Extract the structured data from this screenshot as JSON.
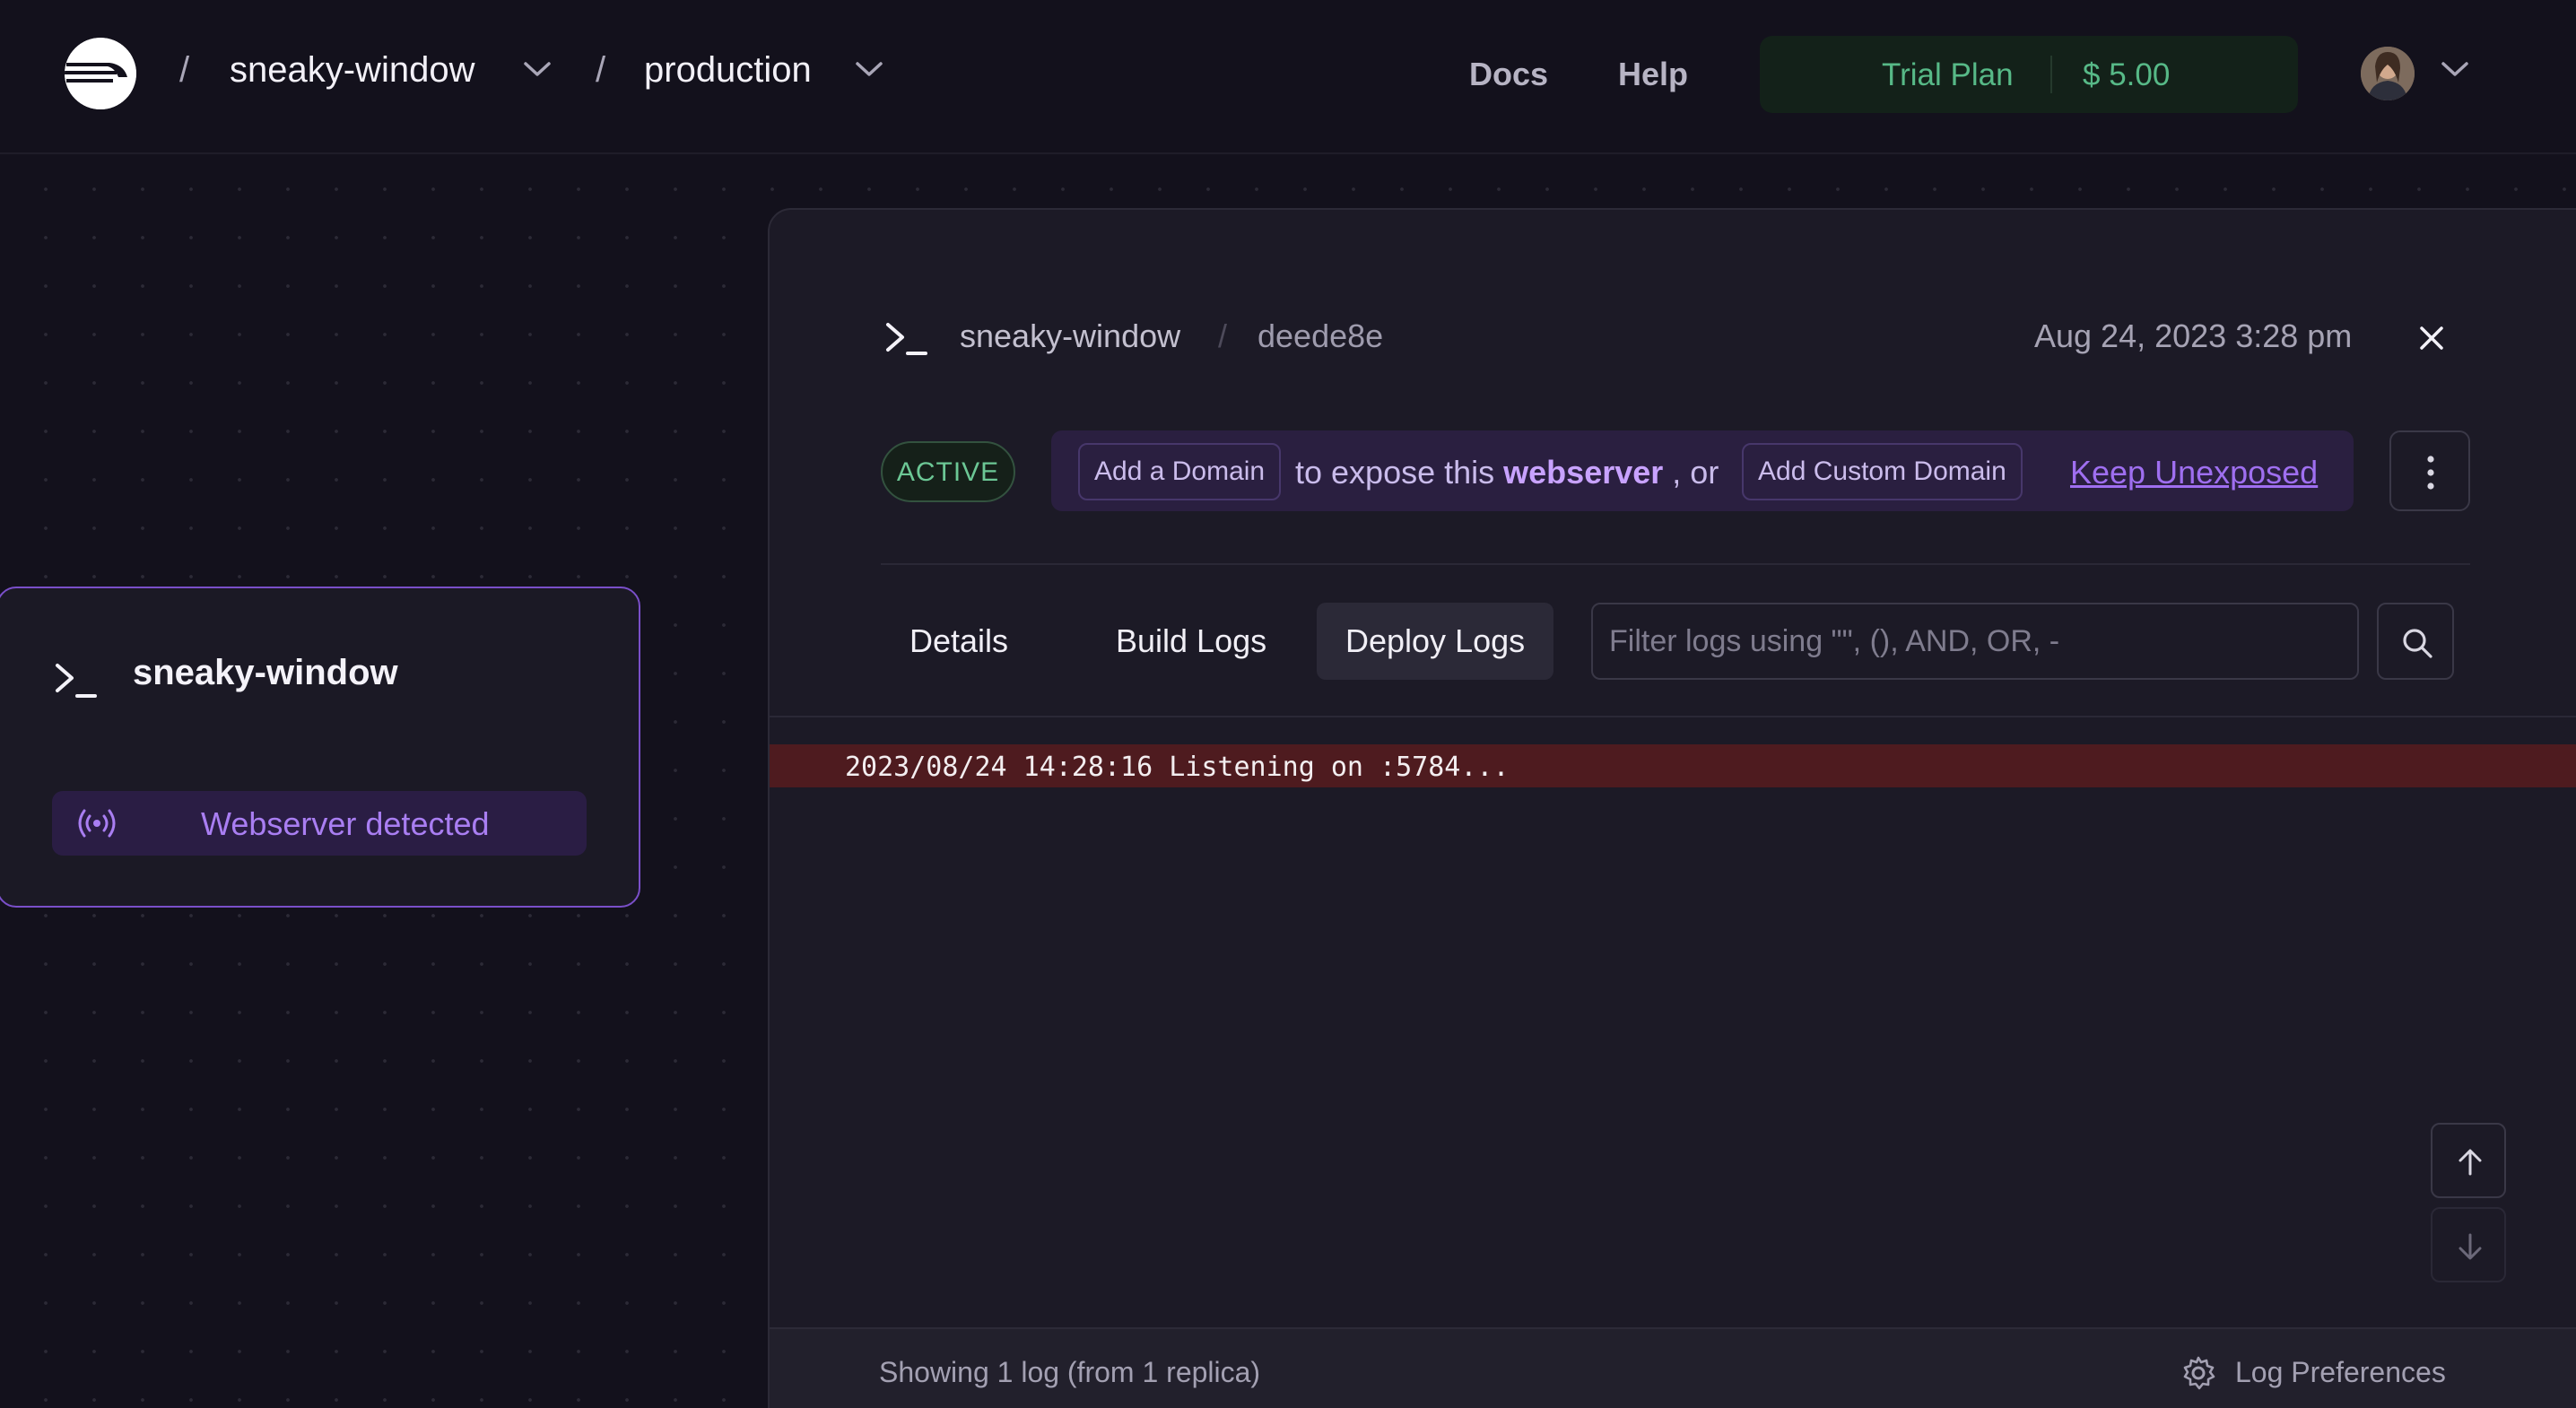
{
  "header": {
    "logo_icon": "railway-logo-icon",
    "breadcrumb": [
      {
        "label": "sneaky-window"
      },
      {
        "label": "production"
      }
    ],
    "breadcrumb_separator": "/",
    "nav": {
      "docs": "Docs",
      "help": "Help"
    },
    "plan": {
      "label": "Trial Plan",
      "amount": "$ 5.00",
      "color": "#57b987"
    },
    "avatar_icon": "user-avatar"
  },
  "canvas": {
    "service_card": {
      "icon": "terminal-icon",
      "name": "sneaky-window",
      "status": "Webserver detected",
      "status_icon": "broadcast-icon",
      "accent": "#7a4fc9"
    }
  },
  "panel": {
    "service": "sneaky-window",
    "separator": "/",
    "commit": "deede8e",
    "date": "Aug 24, 2023 3:28 pm",
    "status_badge": "ACTIVE",
    "domain": {
      "add_domain": "Add a Domain",
      "text_before": "to expose this",
      "emphasis": "webserver",
      "text_after": ", or",
      "add_custom": "Add Custom Domain",
      "keep": "Keep Unexposed"
    },
    "tabs": [
      {
        "label": "Details",
        "active": false
      },
      {
        "label": "Build Logs",
        "active": false
      },
      {
        "label": "Deploy Logs",
        "active": true
      }
    ],
    "filter": {
      "placeholder": "Filter logs using \"\", (), AND, OR, -",
      "value": ""
    },
    "logs": [
      {
        "text": "2023/08/24 14:28:16 Listening on :5784...",
        "level": "error",
        "color": "#4e1b1f"
      }
    ],
    "footer": {
      "count": "Showing 1 log (from 1 replica)",
      "preferences": "Log Preferences"
    }
  }
}
